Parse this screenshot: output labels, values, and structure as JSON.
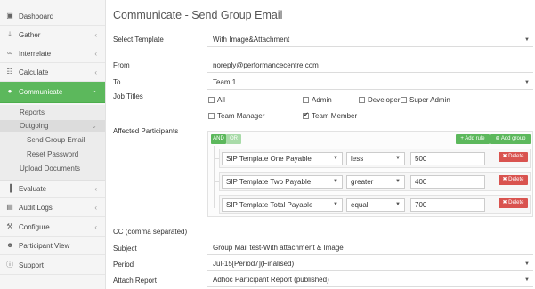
{
  "sidebar": {
    "items": [
      {
        "label": "Dashboard",
        "icon": "dashboard-icon",
        "glyph": "▣",
        "chev": ""
      },
      {
        "label": "Gather",
        "icon": "download-icon",
        "glyph": "⤓",
        "chev": "‹"
      },
      {
        "label": "Interrelate",
        "icon": "link-icon",
        "glyph": "∞",
        "chev": "‹"
      },
      {
        "label": "Calculate",
        "icon": "calculator-icon",
        "glyph": "☷",
        "chev": "‹"
      },
      {
        "label": "Communicate",
        "icon": "chat-icon",
        "glyph": "●",
        "chev": "⌄"
      },
      {
        "label": "Evaluate",
        "icon": "chart-icon",
        "glyph": "▐",
        "chev": "‹"
      },
      {
        "label": "Audit Logs",
        "icon": "audit-icon",
        "glyph": "▤",
        "chev": "‹"
      },
      {
        "label": "Configure",
        "icon": "wrench-icon",
        "glyph": "⚒",
        "chev": "‹"
      },
      {
        "label": "Participant View",
        "icon": "user-icon",
        "glyph": "☻",
        "chev": ""
      },
      {
        "label": "Support",
        "icon": "help-icon",
        "glyph": "ⓘ",
        "chev": ""
      }
    ],
    "sub": {
      "reports": "Reports",
      "outgoing": "Outgoing",
      "send_group_email": "Send Group Email",
      "reset_password": "Reset Password",
      "upload_documents": "Upload Documents"
    }
  },
  "main": {
    "title": "Communicate - Send Group Email",
    "select_template_label": "Select Template",
    "select_template_value": "With Image&Attachment",
    "from_label": "From",
    "from_value": "noreply@performancecentre.com",
    "to_label": "To",
    "to_value": "Team 1",
    "job_titles_label": "Job Titles",
    "job_titles": [
      {
        "label": "All",
        "checked": false
      },
      {
        "label": "Admin",
        "checked": false
      },
      {
        "label": "Developer",
        "checked": false
      },
      {
        "label": "Super Admin",
        "checked": false
      },
      {
        "label": "Team Manager",
        "checked": false
      },
      {
        "label": "Team Member",
        "checked": true
      }
    ],
    "affected_label": "Affected Participants",
    "cc_label": "CC (comma separated)",
    "cc_value": "",
    "subject_label": "Subject",
    "subject_value": "Group Mail test-With attachment & Image",
    "period_label": "Period",
    "period_value": "Jul-15[Period7](Finalised)",
    "attach_label": "Attach Report",
    "attach_value": "Adhoc Participant Report (published)"
  },
  "query_builder": {
    "and_label": "AND",
    "or_label": "OR",
    "add_rule_label": "+ Add rule",
    "add_group_label": "⊕ Add group",
    "delete_label": "✖ Delete",
    "rules": [
      {
        "field": "SIP Template One Payable",
        "operator": "less",
        "value": "500"
      },
      {
        "field": "SIP Template Two Payable",
        "operator": "greater",
        "value": "400"
      },
      {
        "field": "SIP Template Total Payable",
        "operator": "equal",
        "value": "700"
      }
    ]
  }
}
